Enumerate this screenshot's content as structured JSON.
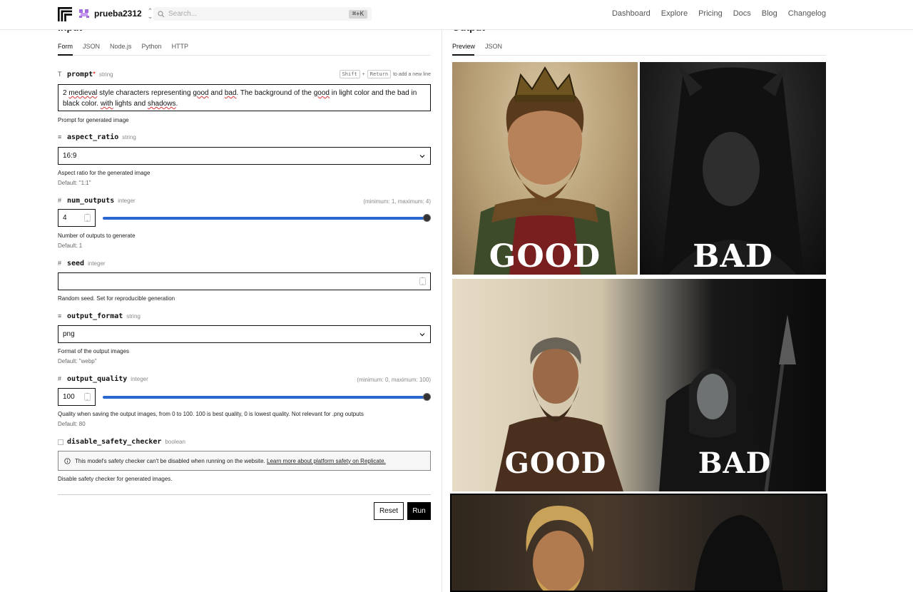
{
  "header": {
    "account": "prueba2312",
    "search_placeholder": "Search...",
    "search_shortcut": "⌘+K",
    "nav": [
      "Dashboard",
      "Explore",
      "Pricing",
      "Docs",
      "Blog",
      "Changelog"
    ]
  },
  "input": {
    "title": "Input",
    "tabs": [
      "Form",
      "JSON",
      "Node.js",
      "Python",
      "HTTP"
    ],
    "prompt": {
      "name": "prompt",
      "required": "*",
      "type": "string",
      "hint_key1": "Shift",
      "hint_plus": "+",
      "hint_key2": "Return",
      "hint_text": "to add a new line",
      "value_parts": [
        "2 ",
        "medieval",
        " style characters representing ",
        "good",
        " and ",
        "bad",
        ". The background of the ",
        "good",
        " in light color and the bad in black color. ",
        "with",
        " lights and ",
        "shadows",
        "."
      ],
      "description": "Prompt for generated image"
    },
    "aspect_ratio": {
      "name": "aspect_ratio",
      "type": "string",
      "value": "16:9",
      "description": "Aspect ratio for the generated image",
      "default": "Default: \"1:1\""
    },
    "num_outputs": {
      "name": "num_outputs",
      "type": "integer",
      "range": "(minimum: 1, maximum: 4)",
      "value": "4",
      "slider_fraction": 1.0,
      "description": "Number of outputs to generate",
      "default": "Default: 1"
    },
    "seed": {
      "name": "seed",
      "type": "integer",
      "value": "",
      "description": "Random seed. Set for reproducible generation"
    },
    "output_format": {
      "name": "output_format",
      "type": "string",
      "value": "png",
      "description": "Format of the output images",
      "default": "Default: \"webp\""
    },
    "output_quality": {
      "name": "output_quality",
      "type": "integer",
      "range": "(minimum: 0, maximum: 100)",
      "value": "100",
      "slider_fraction": 1.0,
      "description": "Quality when saving the output images, from 0 to 100. 100 is best quality, 0 is lowest quality. Not relevant for .png outputs",
      "default": "Default: 80"
    },
    "disable_safety_checker": {
      "name": "disable_safety_checker",
      "type": "boolean",
      "notice": "This model's safety checker can't be disabled when running on the website.",
      "notice_link": "Learn more about platform safety on Replicate.",
      "description": "Disable safety checker for generated images."
    },
    "buttons": {
      "reset": "Reset",
      "run": "Run"
    }
  },
  "output": {
    "title": "Output",
    "tabs": [
      "Preview",
      "JSON"
    ],
    "images": [
      {
        "caption_left": "GOOD",
        "caption_right": "BAD"
      },
      {
        "caption_left": "GOOD",
        "caption_right": "BAD"
      }
    ]
  },
  "colors": {
    "slider": "#2b67d1",
    "accent_purple": "#a36be0"
  }
}
